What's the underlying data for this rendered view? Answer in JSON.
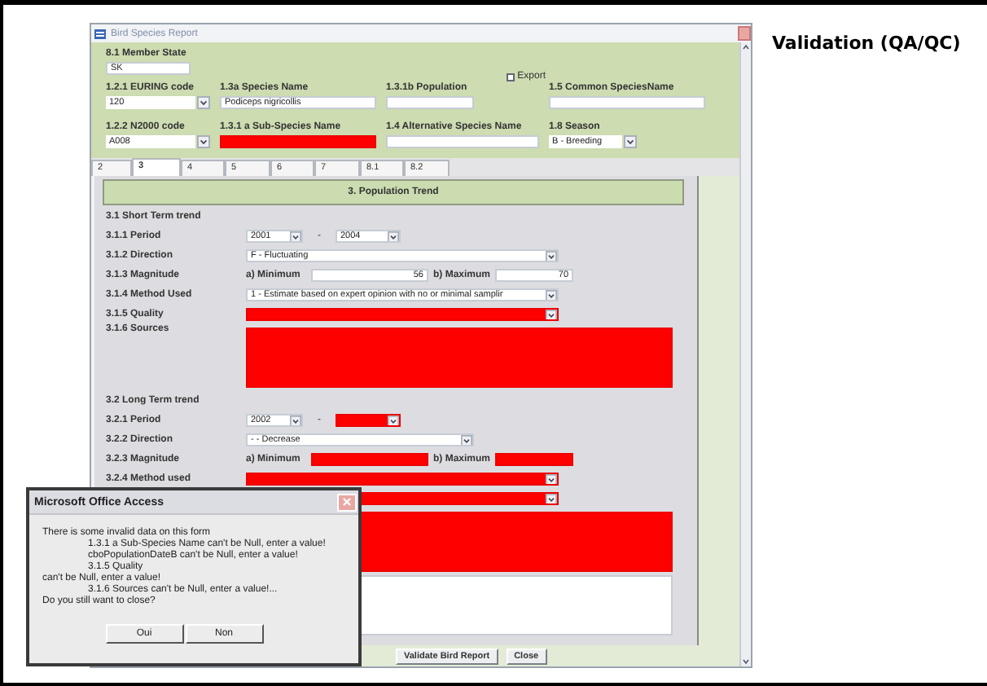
{
  "slide_title": "Validation (QA/QC)",
  "window": {
    "title": "Bird Species Report",
    "header_fields": [
      {
        "label": "8.1 Member State",
        "value": "SK",
        "kind": "text",
        "invalid": false
      },
      {
        "label": "1.2.1 EURING code",
        "value": "120",
        "kind": "select",
        "invalid": false
      },
      {
        "label": "1.3a Species Name",
        "value": "Podiceps nigricollis",
        "kind": "text",
        "invalid": false
      },
      {
        "label": "1.3.1b Population",
        "kind": "text",
        "invalid": false
      },
      {
        "label": "1.5 Common SpeciesName",
        "kind": "text",
        "invalid": false
      },
      {
        "label": "1.2.2 N2000 code",
        "value": "A008",
        "kind": "select",
        "invalid": false
      },
      {
        "label": "1.3.1 a Sub-Species Name",
        "kind": "text",
        "invalid": true
      },
      {
        "label": "1.4 Alternative Species Name",
        "kind": "text",
        "invalid": false
      },
      {
        "label": "1.8 Season",
        "value": "B - Breeding",
        "kind": "select",
        "invalid": false
      }
    ],
    "export": {
      "label": "Export",
      "checked": false
    },
    "tabs": [
      {
        "label": "2",
        "selected": false
      },
      {
        "label": "3",
        "selected": true
      },
      {
        "label": "4",
        "selected": false
      },
      {
        "label": "5",
        "selected": false
      },
      {
        "label": "6",
        "selected": false
      },
      {
        "label": "7",
        "selected": false
      },
      {
        "label": "8.1",
        "selected": false
      },
      {
        "label": "8.2",
        "selected": false
      }
    ],
    "section_title": "3. Population Trend",
    "trend_rows": [
      {
        "kind": "heading",
        "label": "3.1 Short Term trend"
      },
      {
        "kind": "period",
        "label": "3.1.1 Period",
        "from": {
          "value": "2001",
          "invalid": false
        },
        "separator": "-",
        "to": {
          "value": "2004",
          "invalid": false
        }
      },
      {
        "kind": "select",
        "label": "3.1.2 Direction",
        "value": "F - Fluctuating",
        "invalid": false
      },
      {
        "kind": "magnitude",
        "label": "3.1.3 Magnitude",
        "min_label": "a) Minimum",
        "min": {
          "value": "56",
          "invalid": false
        },
        "max_label": "b) Maximum",
        "max": {
          "value": "70",
          "invalid": false
        }
      },
      {
        "kind": "select",
        "label": "3.1.4 Method Used",
        "value": "1 - Estimate based on expert opinion with no or minimal samplir",
        "invalid": false
      },
      {
        "kind": "select",
        "label": "3.1.5 Quality",
        "invalid": true
      },
      {
        "kind": "memo",
        "label": "3.1.6 Sources",
        "invalid": true
      },
      {
        "kind": "heading",
        "label": "3.2 Long Term trend"
      },
      {
        "kind": "period",
        "label": "3.2.1 Period",
        "from": {
          "value": "2002",
          "invalid": false
        },
        "separator": "-",
        "to": {
          "invalid": true
        }
      },
      {
        "kind": "shortselect",
        "label": "3.2.2 Direction",
        "value": "- - Decrease",
        "invalid": false
      },
      {
        "kind": "magnitude",
        "label": "3.2.3 Magnitude",
        "min_label": "a) Minimum",
        "min": {
          "invalid": true
        },
        "max_label": "b) Maximum",
        "max": {
          "invalid": true
        }
      },
      {
        "kind": "select",
        "label": "3.2.4 Method used",
        "invalid": true
      },
      {
        "kind": "select",
        "invalid": true
      },
      {
        "kind": "memo",
        "invalid": true
      },
      {
        "kind": "memo",
        "invalid": false
      }
    ],
    "buttons": [
      "Validate Bird Report",
      "Close"
    ]
  },
  "dialog": {
    "title": "Microsoft Office Access",
    "lines": [
      {
        "text": "There is some invalid data on this form",
        "indented": false
      },
      {
        "text": "1.3.1 a Sub-Species Name can't be Null, enter a value!",
        "indented": true
      },
      {
        "text": "cboPopulationDateB can't be Null, enter a value!",
        "indented": true
      },
      {
        "text": "3.1.5 Quality",
        "indented": true
      },
      {
        "text": "can't be Null, enter a value!",
        "indented": false
      },
      {
        "text": "3.1.6 Sources can't be Null, enter a value!...",
        "indented": true
      },
      {
        "text": "Do you still want to close?",
        "indented": false
      }
    ],
    "buttons": [
      "Oui",
      "Non"
    ]
  }
}
